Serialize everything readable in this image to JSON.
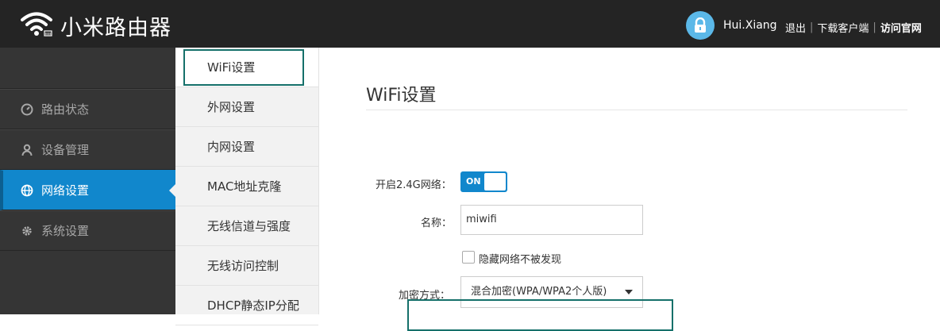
{
  "header": {
    "brand": "小米路由器",
    "user_name": "Hui.Xiang",
    "logout": "退出",
    "download_client": "下载客户端",
    "visit_site": "访问官网"
  },
  "leftnav": {
    "items": [
      {
        "label": "路由状态",
        "icon": "status-icon"
      },
      {
        "label": "设备管理",
        "icon": "user-icon"
      },
      {
        "label": "网络设置",
        "icon": "globe-icon",
        "active": true
      },
      {
        "label": "系统设置",
        "icon": "gear-icon"
      }
    ]
  },
  "subnav": {
    "items": [
      {
        "label": "WiFi设置"
      },
      {
        "label": "外网设置"
      },
      {
        "label": "内网设置"
      },
      {
        "label": "MAC地址克隆"
      },
      {
        "label": "无线信道与强度"
      },
      {
        "label": "无线访问控制"
      },
      {
        "label": "DHCP静态IP分配"
      }
    ]
  },
  "main": {
    "title": "WiFi设置",
    "wifi24_label": "开启2.4G网络：",
    "toggle_text": "ON",
    "name_label": "名称：",
    "name_value": "miwifi",
    "hide_label": "隐藏网络不被发现",
    "encrypt_label": "加密方式：",
    "encrypt_value": "混合加密(WPA/WPA2个人版)"
  },
  "colors": {
    "header_bg": "#242424",
    "accent": "#1187cc",
    "highlight": "#15706a"
  }
}
